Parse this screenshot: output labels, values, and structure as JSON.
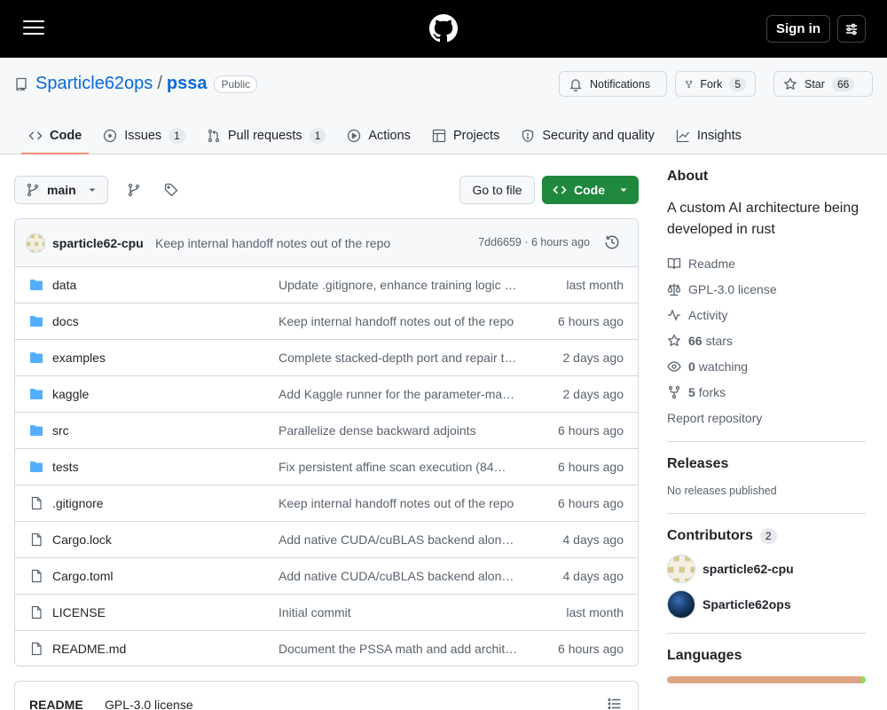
{
  "header": {
    "signin_label": "Sign in"
  },
  "repo": {
    "owner": "Sparticle62ops",
    "slash": "/",
    "name": "pssa",
    "visibility": "Public",
    "notifications_label": "Notifications",
    "fork_label": "Fork",
    "fork_count": "5",
    "star_label": "Star",
    "star_count": "66"
  },
  "tabs": [
    {
      "label": "Code",
      "icon": "code-icon"
    },
    {
      "label": "Issues",
      "count": "1",
      "icon": "issue-icon"
    },
    {
      "label": "Pull requests",
      "count": "1",
      "icon": "pull-request-icon"
    },
    {
      "label": "Actions",
      "icon": "play-icon"
    },
    {
      "label": "Projects",
      "icon": "table-icon"
    },
    {
      "label": "Security and quality",
      "icon": "shield-icon"
    },
    {
      "label": "Insights",
      "icon": "graph-icon"
    }
  ],
  "toolbar": {
    "branch": "main",
    "goto_label": "Go to file",
    "code_label": "Code"
  },
  "commit": {
    "author": "sparticle62-cpu",
    "message": "Keep internal handoff notes out of the repo",
    "meta": "7dd6659 · 6 hours ago"
  },
  "files": [
    {
      "name": "data",
      "type": "dir",
      "message": "Update .gitignore, enhance training logic and documentation",
      "date": "last month"
    },
    {
      "name": "docs",
      "type": "dir",
      "message": "Keep internal handoff notes out of the repo",
      "date": "6 hours ago"
    },
    {
      "name": "examples",
      "type": "dir",
      "message": "Complete stacked-depth port and repair tooling",
      "date": "2 days ago"
    },
    {
      "name": "kaggle",
      "type": "dir",
      "message": "Add Kaggle runner for the parameter-matched sweep",
      "date": "2 days ago"
    },
    {
      "name": "src",
      "type": "dir",
      "message": "Parallelize dense backward adjoints",
      "date": "6 hours ago"
    },
    {
      "name": "tests",
      "type": "dir",
      "message": "Fix persistent affine scan execution (84…",
      "date": "6 hours ago"
    },
    {
      "name": ".gitignore",
      "type": "file",
      "message": "Keep internal handoff notes out of the repo",
      "date": "6 hours ago"
    },
    {
      "name": "Cargo.lock",
      "type": "file",
      "message": "Add native CUDA/cuBLAS backend along with kernels",
      "date": "4 days ago"
    },
    {
      "name": "Cargo.toml",
      "type": "file",
      "message": "Add native CUDA/cuBLAS backend along with kernels",
      "date": "4 days ago"
    },
    {
      "name": "LICENSE",
      "type": "file",
      "message": "Initial commit",
      "date": "last month"
    },
    {
      "name": "README.md",
      "type": "file",
      "message": "Document the PSSA math and add architecture notes",
      "date": "6 hours ago"
    }
  ],
  "readme_tabs": [
    "README",
    "GPL-3.0 license"
  ],
  "about": {
    "heading": "About",
    "description": "A custom AI architecture being developed in rust",
    "readme": "Readme",
    "license": "GPL-3.0 license",
    "activity": "Activity",
    "stars_count": "66",
    "stars_label": "stars",
    "watching_count": "0",
    "watching_label": "watching",
    "forks_count": "5",
    "forks_label": "forks",
    "report": "Report repository"
  },
  "releases": {
    "heading": "Releases",
    "none": "No releases published"
  },
  "contributors": {
    "heading": "Contributors",
    "count": "2",
    "people": [
      "sparticle62-cpu",
      "Sparticle62ops"
    ]
  },
  "languages": {
    "heading": "Languages",
    "colors": [
      "#dea584",
      "#89e051"
    ]
  },
  "colors": {
    "accent": "#0969da",
    "primary_button": "#1f883d",
    "tab_underline": "#fd8c73"
  }
}
